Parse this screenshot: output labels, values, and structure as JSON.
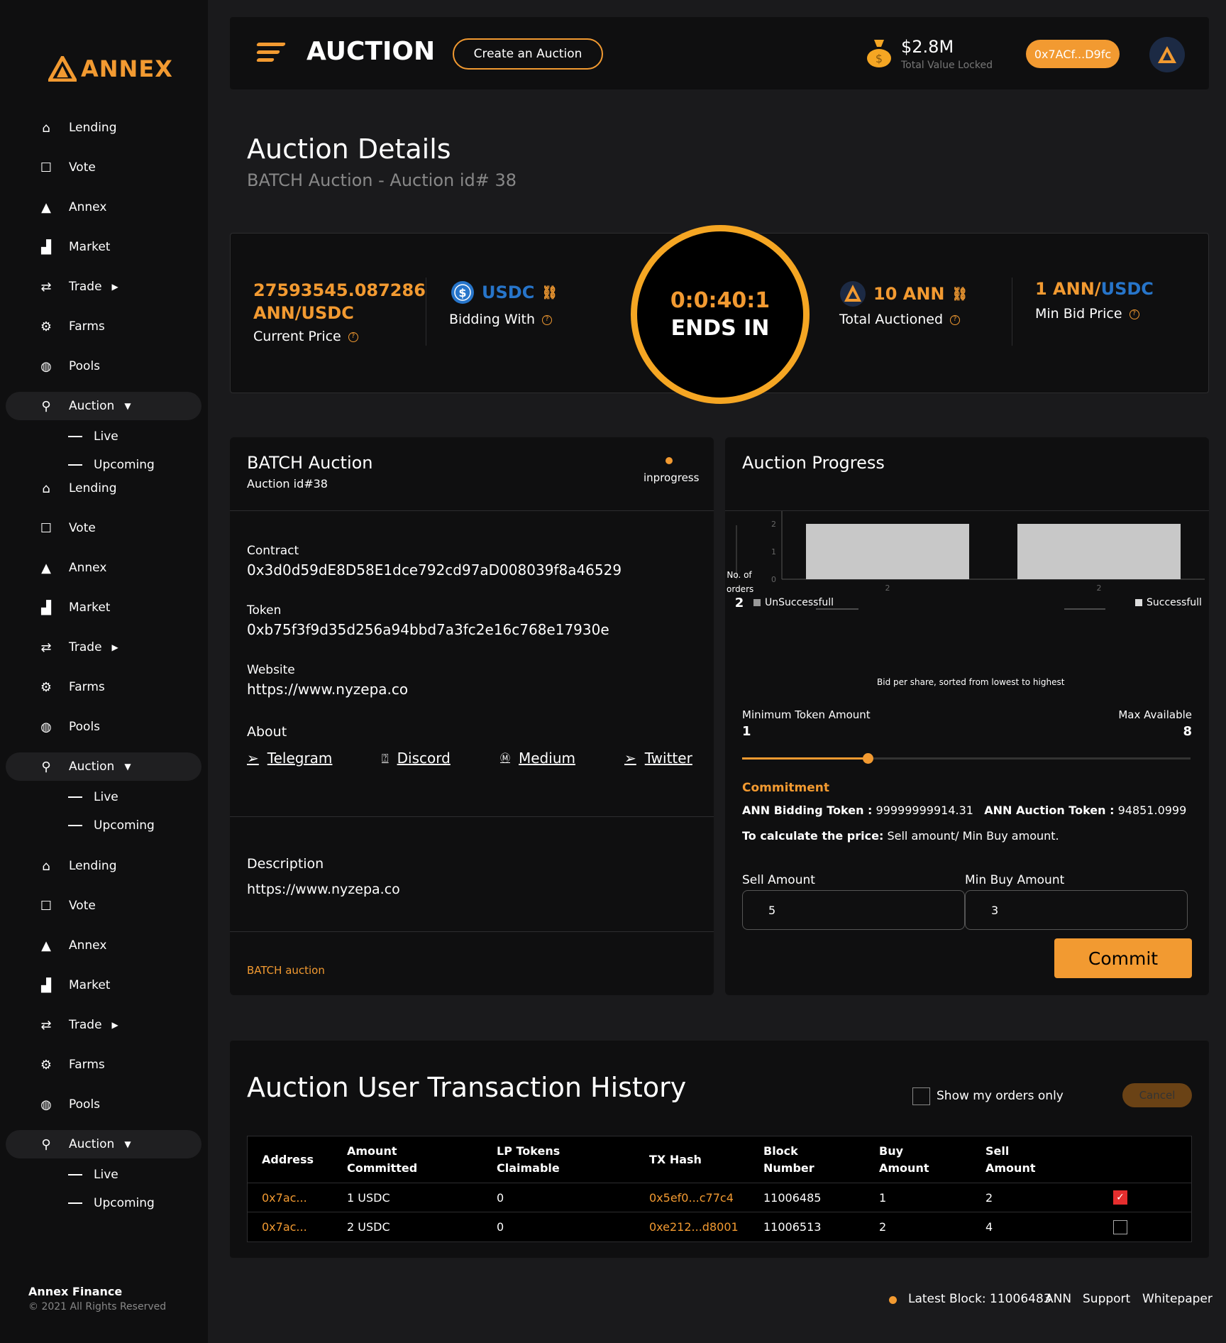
{
  "brand": {
    "name": "ANNEX"
  },
  "sidebar": {
    "groups": [
      {
        "items": [
          {
            "label": "Lending",
            "icon": "home-icon"
          },
          {
            "label": "Vote",
            "icon": "square-icon"
          },
          {
            "label": "Annex",
            "icon": "annex-icon"
          },
          {
            "label": "Market",
            "icon": "chart-icon"
          },
          {
            "label": "Trade",
            "icon": "swap-icon"
          },
          {
            "label": "Farms",
            "icon": "tractor-icon"
          },
          {
            "label": "Pools",
            "icon": "pool-icon"
          },
          {
            "label": "Auction",
            "icon": "auction-icon"
          }
        ],
        "sub": [
          "Live",
          "Upcoming"
        ]
      }
    ],
    "footer_title": "Annex Finance",
    "footer_copy": "© 2021 All Rights Reserved"
  },
  "topbar": {
    "title": "AUCTION",
    "create_label": "Create an Auction",
    "tvl_value": "$2.8M",
    "tvl_label": "Total Value Locked",
    "address": "0x7ACf...D9fc"
  },
  "page": {
    "title": "Auction Details",
    "subtitle": "BATCH Auction - Auction id# 38"
  },
  "stats": {
    "price_value": "27593545.087286",
    "price_unit": "ANN/USDC",
    "price_label": "Current Price",
    "bidding_token": "USDC",
    "bidding_label": "Bidding With",
    "timer": "0:0:40:1",
    "timer_label": "ENDS IN",
    "auctioned": "10 ANN",
    "auctioned_label": "Total Auctioned",
    "min_bid_left": "1 ANN",
    "min_bid_right": "USDC",
    "min_bid_label": "Min Bid Price"
  },
  "details": {
    "title": "BATCH Auction",
    "sub": "Auction id#38",
    "status": "inprogress",
    "contract_label": "Contract",
    "contract": "0x3d0d59dE8D58E1dce792cd97aD008039f8a46529",
    "token_label": "Token",
    "token": "0xb75f3f9d35d256a94bbd7a3fc2e16c768e17930e",
    "website_label": "Website",
    "website": "https://www.nyzepa.co",
    "about_label": "About",
    "socials": [
      "Telegram",
      "Discord",
      "Medium",
      "Twitter"
    ],
    "description_label": "Description",
    "description": "https://www.nyzepa.co",
    "footer_note": "BATCH auction"
  },
  "progress": {
    "title": "Auction Progress",
    "legend_left": "UnSuccessfull",
    "legend_right": "Successfull",
    "y_axis_label_1": "No. of",
    "y_axis_label_2": "orders",
    "y_axis_value": "2",
    "x_axis_label": "Bid per share, sorted from lowest to highest",
    "min_label": "Minimum Token Amount",
    "min_value": "1",
    "max_label": "Max Available",
    "max_value": "8",
    "slider_fraction": 0.28,
    "commitment_title": "Commitment",
    "bidding_token_label": "ANN Bidding Token :",
    "bidding_token_value": "99999999914.31",
    "auction_token_label": "ANN Auction Token :",
    "auction_token_value": "94851.0999",
    "calc_label": "To calculate the price:",
    "calc_text": "Sell amount/ Min Buy amount.",
    "sell_label": "Sell Amount",
    "sell_value": "5",
    "minbuy_label": "Min Buy Amount",
    "minbuy_value": "3",
    "commit_label": "Commit"
  },
  "chart_data": {
    "type": "bar",
    "categories": [
      "2",
      "2"
    ],
    "series": [
      {
        "name": "UnSuccessfull",
        "values": [
          2,
          0
        ]
      },
      {
        "name": "Successfull",
        "values": [
          0,
          2
        ]
      }
    ],
    "yticks": [
      "0",
      "1",
      "2",
      "4"
    ],
    "ylim": [
      0,
      4
    ],
    "xlabel": "Bid per share, sorted from lowest to highest",
    "ylabel": "No. of orders",
    "legend": "top"
  },
  "history": {
    "title": "Auction User Transaction History",
    "show_mine_label": "Show my orders only",
    "cancel_label": "Cancel",
    "columns": [
      [
        "Address",
        ""
      ],
      [
        "Amount",
        "Committed"
      ],
      [
        "LP Tokens",
        "Claimable"
      ],
      [
        "TX Hash",
        ""
      ],
      [
        "Block",
        "Number"
      ],
      [
        "Buy",
        "Amount"
      ],
      [
        "Sell",
        "Amount"
      ]
    ],
    "rows": [
      {
        "address": "0x7ac...",
        "amount": "1 USDC",
        "lp": "0",
        "tx": "0x5ef0...c77c4",
        "block": "11006485",
        "buy": "1",
        "sell": "2",
        "checked": true
      },
      {
        "address": "0x7ac...",
        "amount": "2 USDC",
        "lp": "0",
        "tx": "0xe212...d8001",
        "block": "11006513",
        "buy": "2",
        "sell": "4",
        "checked": false
      }
    ]
  },
  "footer": {
    "latest_block": "Latest Block: 11006483",
    "ann": "ANN",
    "support": "Support",
    "whitepaper": "Whitepaper"
  },
  "colors": {
    "accent": "#f29a31",
    "usdc": "#2775ca",
    "bar": "#c8c8c8"
  }
}
